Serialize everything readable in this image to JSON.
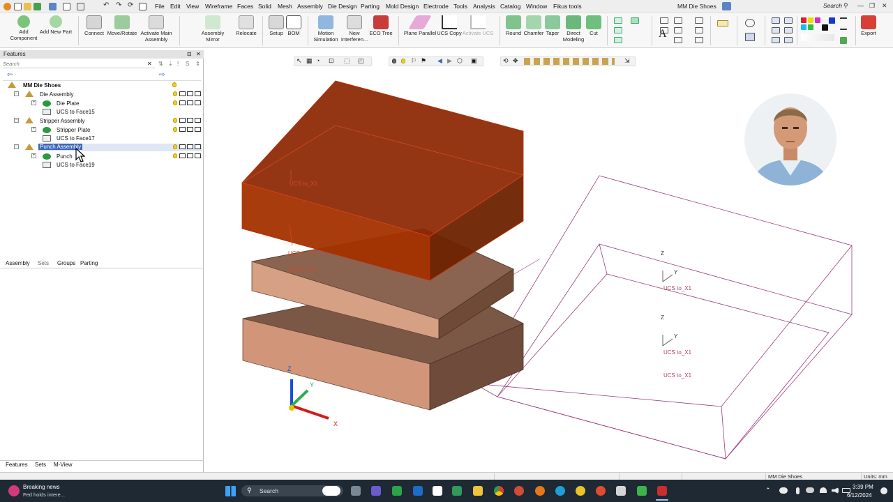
{
  "titlebar": {
    "menus": [
      "File",
      "Edit",
      "View",
      "Wireframe",
      "Faces",
      "Solid",
      "Mesh",
      "Assembly",
      "Die Design",
      "Parting",
      "Mold Design",
      "Electrode",
      "Tools",
      "Analysis",
      "Catalog",
      "Window",
      "Fikus tools"
    ],
    "title": "MM Die Shoes",
    "search_label": "Search",
    "win_minimize": "—",
    "win_restore": "❐",
    "win_close": "✕"
  },
  "ribbon": {
    "add_component": "Add Component",
    "add_new_part": "Add New Part",
    "connect": "Connect",
    "move_rotate": "Move/Rotate",
    "activate_main": "Activate Main Assembly",
    "assembly_mirror": "Assembly Mirror",
    "relocate": "Relocate",
    "setup": "Setup",
    "bom": "BOM",
    "motion_sim": "Motion Simulation",
    "new_interference": "New Interferen...",
    "eco_tree": "ECO Tree",
    "plane_parallel": "Plane Parallel",
    "ucs_copy": "UCS Copy",
    "activate_ucs": "Activate UCS",
    "round": "Round",
    "chamfer": "Chamfer",
    "taper": "Taper",
    "direct_modeling": "Direct Modeling",
    "cut": "Cut",
    "export": "Export"
  },
  "panel": {
    "title": "Features",
    "pin": "⊟",
    "close": "✕",
    "search_placeholder": "Search",
    "search_clear": "✕",
    "tree": {
      "root": "MM Die Shoes",
      "die_assembly": "Die Assembly",
      "die_plate": "Die Plate",
      "ucs_face15": "UCS to Face15",
      "stripper_assembly": "Stripper Assembly",
      "stripper_plate": "Stripper Plate",
      "ucs_face17": "UCS to Face17",
      "punch_assembly": "Punch Assembly",
      "punch": "Punch",
      "ucs_face19": "UCS to Face19"
    },
    "tabs_mid": [
      "Assembly",
      "Sets",
      "Groups",
      "Parting"
    ],
    "tabs_bottom": [
      "Features",
      "Sets",
      "M-View"
    ]
  },
  "viewport": {
    "ucs_label": "UCS to_X1",
    "axis_x": "X",
    "axis_y": "Y",
    "axis_z": "Z"
  },
  "status": {
    "file": "MM Die Shoes",
    "units": "Units: mm"
  },
  "taskbar": {
    "news_title": "Breaking news",
    "news_sub": "Fed holds intere...",
    "search": "Search",
    "time": "3:39 PM",
    "date": "6/12/2024"
  },
  "colors": {
    "selected_body": "#8b2500",
    "plate_light": "#d1967a",
    "plate_dark": "#6e4b3a",
    "wire": "#9b3b7a",
    "accent": "#3b67b8"
  }
}
